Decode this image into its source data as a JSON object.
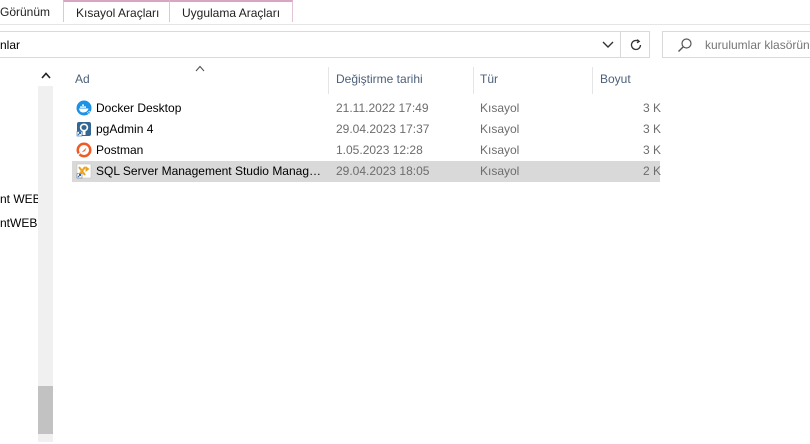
{
  "ribbon": {
    "tabs": [
      {
        "label": "Görünüm"
      },
      {
        "label": "Kısayol Araçları"
      },
      {
        "label": "Uygulama Araçları"
      }
    ]
  },
  "address": {
    "path": "nlar",
    "dropdown_icon": "chevron-down-icon",
    "refresh_icon": "refresh-icon"
  },
  "search": {
    "placeholder": "kurulumlar klasörün"
  },
  "nav": {
    "items": [
      {
        "label": "nt WEB"
      },
      {
        "label": "ntWEB"
      }
    ]
  },
  "columns": {
    "name": "Ad",
    "date": "Değiştirme tarihi",
    "type": "Tür",
    "size": "Boyut"
  },
  "files": [
    {
      "name": "Docker Desktop",
      "date": "21.11.2022 17:49",
      "type": "Kısayol",
      "size": "3 K",
      "icon": "docker-icon"
    },
    {
      "name": "pgAdmin 4",
      "date": "29.04.2023 17:37",
      "type": "Kısayol",
      "size": "3 K",
      "icon": "pgadmin-icon"
    },
    {
      "name": "Postman",
      "date": "1.05.2023 12:28",
      "type": "Kısayol",
      "size": "3 K",
      "icon": "postman-icon"
    },
    {
      "name": "SQL Server Management Studio Manage...",
      "date": "29.04.2023 18:05",
      "type": "Kısayol",
      "size": "2 K",
      "icon": "ssms-icon",
      "selected": true
    }
  ],
  "colors": {
    "selection": "#d9d9d9",
    "header_text": "#4c607a",
    "meta_text": "#6d6d6d"
  }
}
